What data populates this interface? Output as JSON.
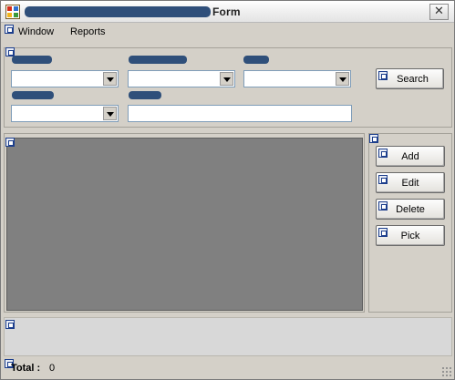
{
  "window": {
    "title": "Form",
    "close_glyph": "✕",
    "icon": "app-form-icon"
  },
  "menu": {
    "items": [
      "Window",
      "Reports"
    ]
  },
  "filters": {
    "search_label": "Search"
  },
  "actions": {
    "add": "Add",
    "edit": "Edit",
    "delete": "Delete",
    "pick": "Pick"
  },
  "status": {
    "total_label": "Total :",
    "total_value": "0"
  },
  "colors": {
    "grid_background": "#808080",
    "window_face": "#d4d0c8",
    "redaction": "#2f4f7a"
  }
}
